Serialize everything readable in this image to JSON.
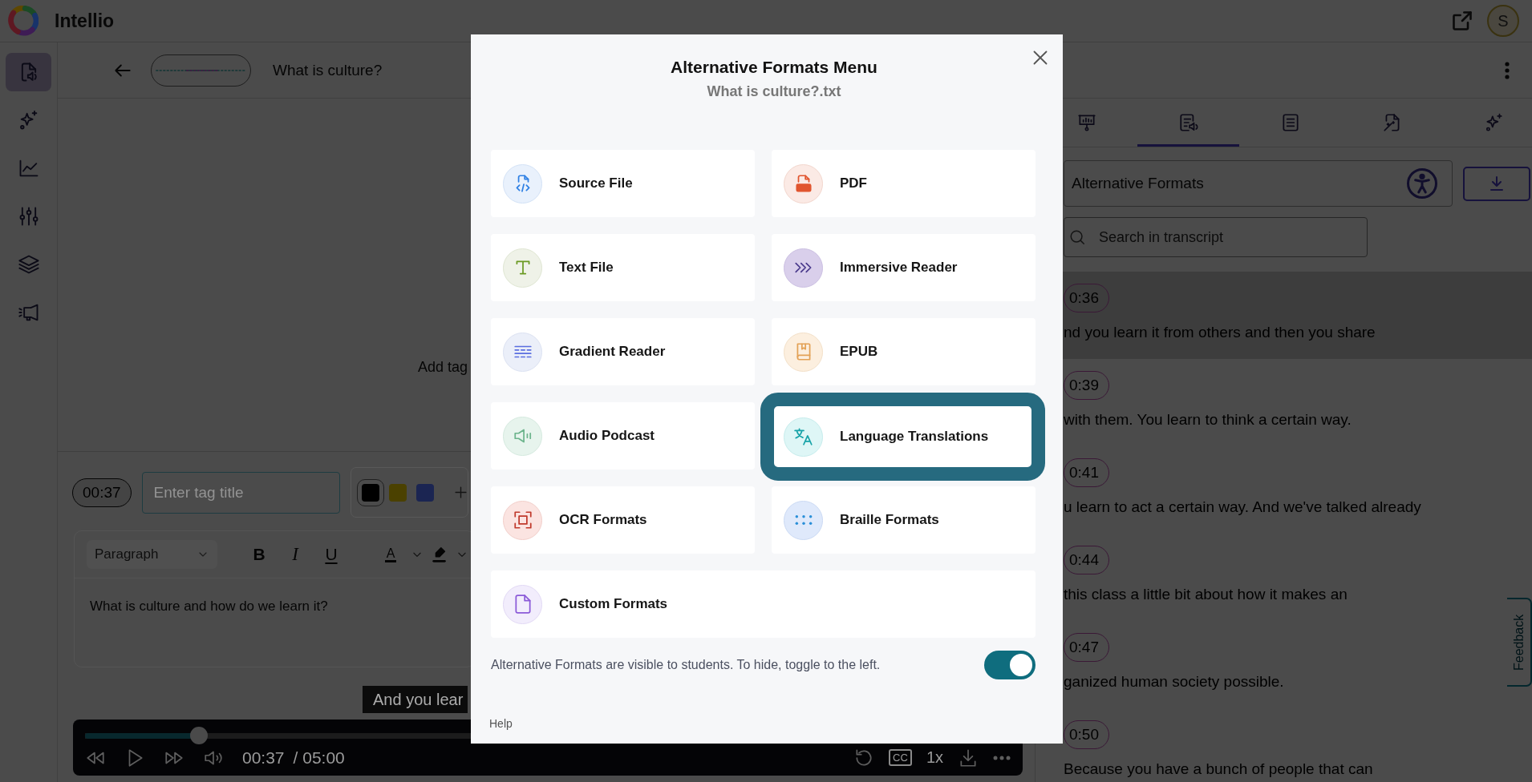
{
  "header": {
    "app_name": "Intellio",
    "avatar_initial": "S"
  },
  "sidebar": {
    "items": [
      {
        "selected": true
      },
      {
        "selected": false
      },
      {
        "selected": false
      },
      {
        "selected": false
      },
      {
        "selected": false
      },
      {
        "selected": false
      }
    ]
  },
  "top_bar": {
    "title": "What is culture?"
  },
  "tags_panel": {
    "empty_hint": "Add tag"
  },
  "tag_editor": {
    "time": "00:37",
    "title_field": {
      "placeholder": "Enter tag title"
    },
    "swatches": [
      {
        "color": "#000000",
        "selected": true
      },
      {
        "color": "#4b4100",
        "selected": false
      },
      {
        "color": "#1b2552",
        "selected": false
      }
    ],
    "block_format": "Paragraph",
    "toolbar": [
      "B",
      "I",
      "U"
    ],
    "text_color_label": "A",
    "body": "What is culture and how do we learn it?"
  },
  "caption": "And you lear",
  "player": {
    "level": 0.123,
    "current_time": "00:37",
    "duration": "/ 05:00",
    "captions_label": "CC",
    "speed": "1x"
  },
  "transcript_panel": {
    "tabs": [
      {
        "selected": false
      },
      {
        "selected": true
      },
      {
        "selected": false
      },
      {
        "selected": false
      },
      {
        "selected": false
      }
    ],
    "view_select": {
      "value": "Alternative Formats"
    },
    "search": {
      "placeholder": "Search in transcript"
    },
    "segments": [
      {
        "time": "0:36",
        "text": "nd you learn it from others and then you share",
        "selected": true
      },
      {
        "time": "0:39",
        "text": "with them. You learn to think a certain way.",
        "selected": false
      },
      {
        "time": "0:41",
        "text": "u learn to act a certain way. And we've talked already",
        "selected": false
      },
      {
        "time": "0:44",
        "text": "this class a little bit about how it makes an",
        "selected": false
      },
      {
        "time": "0:47",
        "text": "ganized human society possible.",
        "selected": false
      },
      {
        "time": "0:50",
        "text": "Because you have a bunch of people that can",
        "selected": false
      }
    ]
  },
  "feedback_tab": "Feedback",
  "modal": {
    "title": "Alternative Formats Menu",
    "subtitle": "What is culture?.txt",
    "formats": [
      {
        "label": "Source File",
        "selected": false
      },
      {
        "label": "PDF",
        "selected": false
      },
      {
        "label": "Text File",
        "selected": false
      },
      {
        "label": "Immersive Reader",
        "selected": false
      },
      {
        "label": "Gradient Reader",
        "selected": false
      },
      {
        "label": "EPUB",
        "selected": false
      },
      {
        "label": "Audio Podcast",
        "selected": false
      },
      {
        "label": "Language Translations",
        "selected": true
      },
      {
        "label": "OCR Formats",
        "selected": false
      },
      {
        "label": "Braille Formats",
        "selected": false
      },
      {
        "label": "Custom Formats",
        "selected": false
      }
    ],
    "visibility": {
      "text": "Alternative Formats are visible to students. To hide, toggle to the left.",
      "on": true
    },
    "help": "Help"
  }
}
